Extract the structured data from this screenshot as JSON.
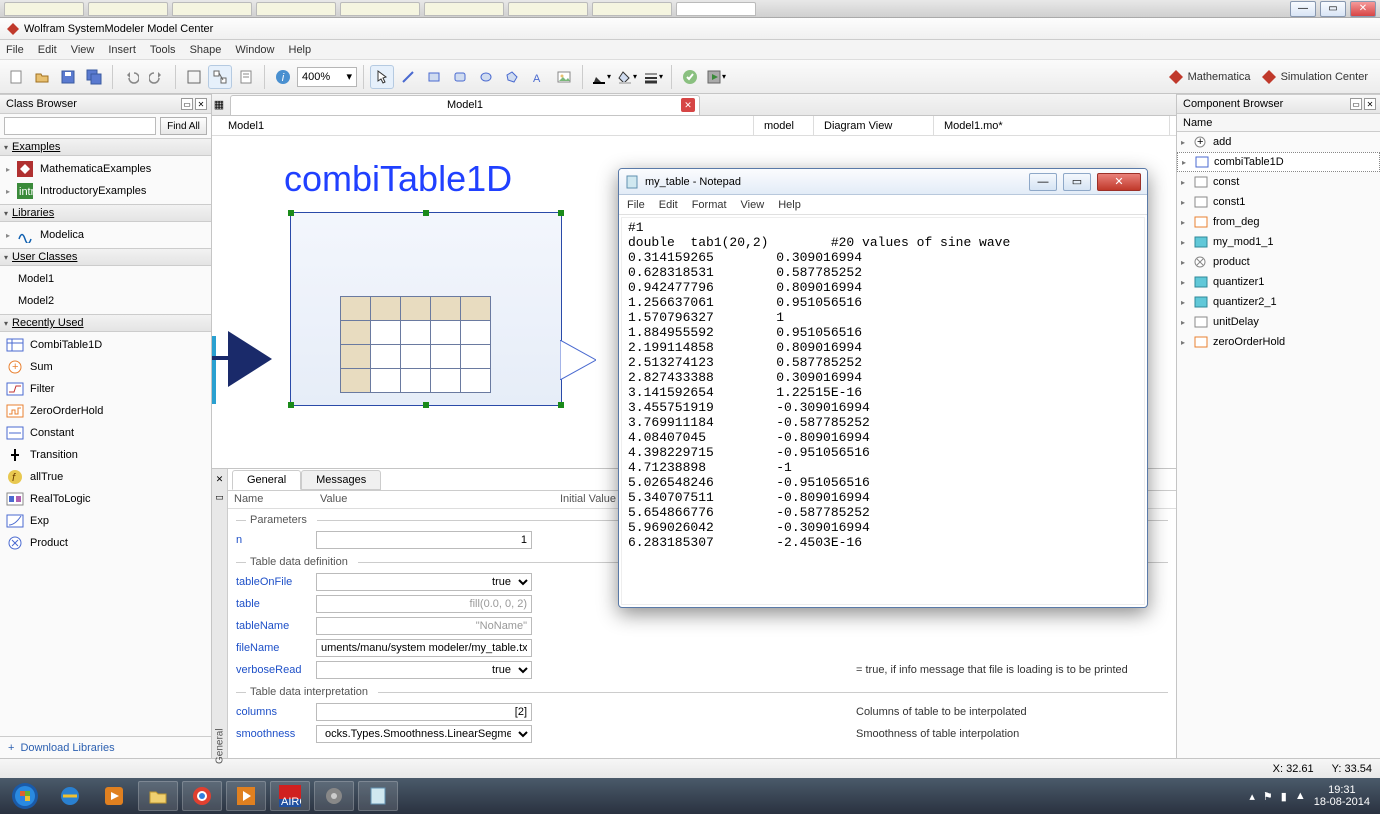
{
  "browser_tabs": 9,
  "window": {
    "title": "Wolfram SystemModeler Model Center"
  },
  "menu": [
    "File",
    "Edit",
    "View",
    "Insert",
    "Tools",
    "Shape",
    "Window",
    "Help"
  ],
  "toolbar": {
    "zoom": "400%",
    "brands": [
      {
        "name": "Mathematica"
      },
      {
        "name": "Simulation Center"
      }
    ]
  },
  "class_browser": {
    "title": "Class Browser",
    "find_all": "Find All",
    "sections": {
      "examples": {
        "title": "Examples",
        "items": [
          "MathematicaExamples",
          "IntroductoryExamples"
        ]
      },
      "libraries": {
        "title": "Libraries",
        "items": [
          "Modelica"
        ]
      },
      "user_classes": {
        "title": "User Classes",
        "items": [
          "Model1",
          "Model2"
        ]
      },
      "recently_used": {
        "title": "Recently Used",
        "items": [
          "CombiTable1D",
          "Sum",
          "Filter",
          "ZeroOrderHold",
          "Constant",
          "Transition",
          "allTrue",
          "RealToLogic",
          "Exp",
          "Product"
        ]
      }
    },
    "download": "Download Libraries"
  },
  "center": {
    "tab_label": "Model1",
    "breadcrumb": {
      "model": "Model1",
      "kind": "model",
      "view": "Diagram View",
      "file": "Model1.mo*"
    },
    "block_title": "combiTable1D"
  },
  "params": {
    "tabs": [
      "General",
      "Messages"
    ],
    "head": {
      "name": "Name",
      "value": "Value",
      "initial": "Initial Value"
    },
    "groups": {
      "parameters": "Parameters",
      "table_def": "Table data definition",
      "table_interp": "Table data interpretation"
    },
    "rows": {
      "n_name": "n",
      "n_val": "1",
      "tableOnFile_name": "tableOnFile",
      "tableOnFile_val": "true",
      "table_name": "table",
      "table_val": "fill(0.0, 0, 2)",
      "tableName_name": "tableName",
      "tableName_val": "\"NoName\"",
      "fileName_name": "fileName",
      "fileName_val": "uments/manu/system modeler/my_table.txt\"",
      "verboseRead_name": "verboseRead",
      "verboseRead_val": "true",
      "verboseRead_desc": "= true, if info message that file is loading is to be printed",
      "columns_name": "columns",
      "columns_val": "[2]",
      "columns_desc": "Columns of table to be interpolated",
      "smoothness_name": "smoothness",
      "smoothness_val": "ocks.Types.Smoothness.LinearSegments",
      "smoothness_desc": "Smoothness of table interpolation"
    }
  },
  "component_browser": {
    "title": "Component Browser",
    "name_head": "Name",
    "items": [
      "add",
      "combiTable1D",
      "const",
      "const1",
      "from_deg",
      "my_mod1_1",
      "product",
      "quantizer1",
      "quantizer2_1",
      "unitDelay",
      "zeroOrderHold"
    ]
  },
  "status": {
    "x_label": "X:",
    "x": "32.61",
    "y_label": "Y:",
    "y": "33.54"
  },
  "notepad": {
    "title": "my_table - Notepad",
    "menu": [
      "File",
      "Edit",
      "Format",
      "View",
      "Help"
    ],
    "body": "#1\ndouble  tab1(20,2)        #20 values of sine wave\n0.314159265        0.309016994\n0.628318531        0.587785252\n0.942477796        0.809016994\n1.256637061        0.951056516\n1.570796327        1\n1.884955592        0.951056516\n2.199114858        0.809016994\n2.513274123        0.587785252\n2.827433388        0.309016994\n3.141592654        1.22515E-16\n3.455751919        -0.309016994\n3.769911184        -0.587785252\n4.08407045         -0.809016994\n4.398229715        -0.951056516\n4.71238898         -1\n5.026548246        -0.951056516\n5.340707511        -0.809016994\n5.654866776        -0.587785252\n5.969026042        -0.309016994\n6.283185307        -2.4503E-16"
  },
  "taskbar": {
    "time": "19:31",
    "date": "18-08-2014"
  }
}
